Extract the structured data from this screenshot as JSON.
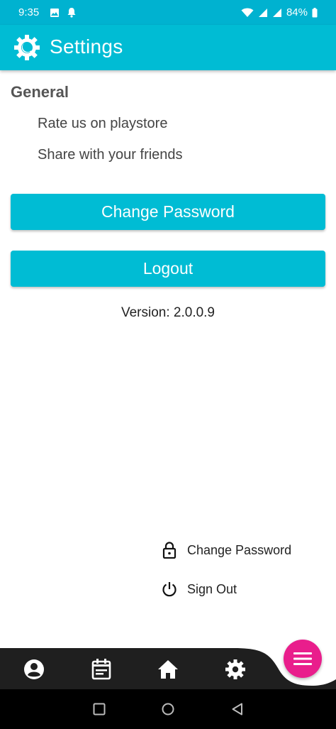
{
  "status_bar": {
    "time": "9:35",
    "battery": "84%",
    "left_icons": [
      "image-icon",
      "bell-icon"
    ],
    "right_icons": [
      "wifi-icon",
      "signal-icon",
      "signal-icon",
      "battery-icon"
    ]
  },
  "app_bar": {
    "title": "Settings",
    "logo_icon": "gear-wrench-icon"
  },
  "general": {
    "title": "General",
    "items": [
      {
        "label": "Rate us on playstore"
      },
      {
        "label": "Share with your friends"
      }
    ]
  },
  "buttons": {
    "change_password": "Change Password",
    "logout": "Logout"
  },
  "version": "Version: 2.0.0.9",
  "popup_menu": {
    "items": [
      {
        "label": "Change Password",
        "icon": "lock-icon"
      },
      {
        "label": "Sign Out",
        "icon": "power-icon"
      }
    ]
  },
  "bottom_nav": {
    "items": [
      "profile-icon",
      "calendar-icon",
      "home-icon",
      "settings-icon"
    ],
    "fab_icon": "menu-icon"
  },
  "colors": {
    "primary": "#00bcd4",
    "status_bar": "#00b2d0",
    "fab": "#e91e8c",
    "nav_bg": "#1f1f1f"
  }
}
